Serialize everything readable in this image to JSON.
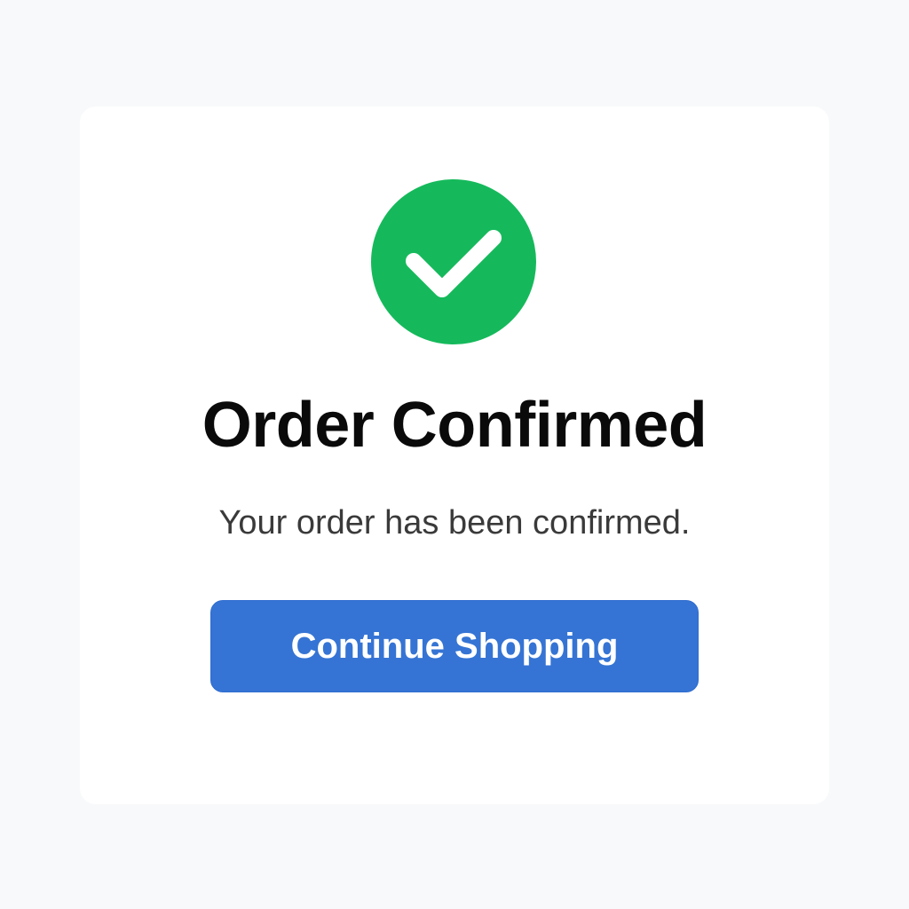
{
  "confirmation": {
    "icon": "check-circle-icon",
    "title": "Order Confirmed",
    "message": "Your order has been confirmed.",
    "button_label": "Continue Shopping"
  },
  "colors": {
    "success": "#15b95b",
    "check_mark": "#ffffff",
    "button": "#3574d4",
    "background": "#f8f9fa",
    "card": "#ffffff"
  }
}
